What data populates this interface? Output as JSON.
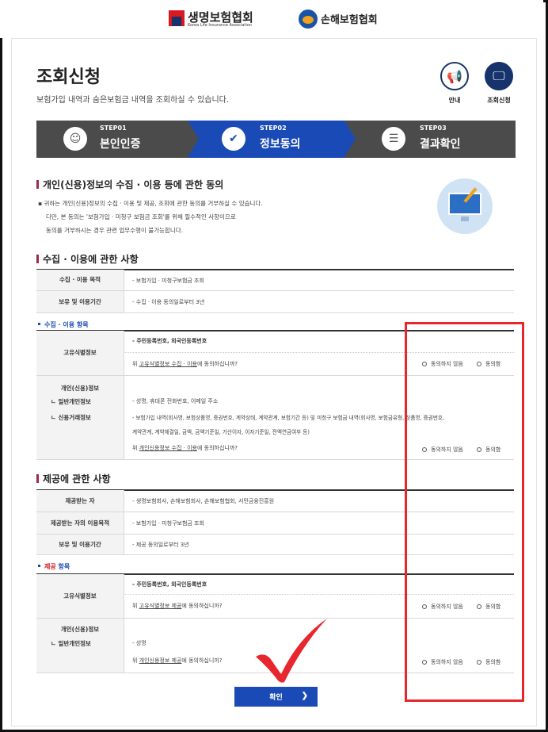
{
  "header": {
    "logo1_text": "생명보험협회",
    "logo1_sub": "Korea Life Insurance Association",
    "logo2_text": "손해보험협회"
  },
  "page": {
    "title": "조회신청",
    "description": "보험가입 내역과 숨은보험금 내역을 조회하실 수 있습니다."
  },
  "top_icons": [
    {
      "label": "안내",
      "icon": "megaphone-icon"
    },
    {
      "label": "조회신청",
      "icon": "monitor-icon"
    }
  ],
  "steps": [
    {
      "num": "STEP01",
      "label": "본인인증",
      "icon": "user-icon"
    },
    {
      "num": "STEP02",
      "label": "정보동의",
      "icon": "check-icon"
    },
    {
      "num": "STEP03",
      "label": "결과확인",
      "icon": "document-icon"
    }
  ],
  "section1": {
    "title": "개인(신용)정보의 수집 · 이용 등에 관한 동의",
    "notes": [
      "귀하는 개인(신용)정보의 수집 · 이용 및 제공, 조회에 관한 동의를 거부하실 수 있습니다.",
      "다만, 본 동의는 '보험가입 · 미청구 보험금 조회'를 위해 필수적인 사항이므로",
      "동의를 거부하시는 경우 관련 업무수행이 불가능합니다."
    ]
  },
  "collect": {
    "title": "수집 · 이용에 관한 사항",
    "rows": [
      {
        "th": "수집 · 이용 목적",
        "td": "- 보험가입 · 미청구보험금 조회"
      },
      {
        "th": "보유 및 이용기간",
        "td": "- 수집 · 이용 동의일로부터 3년"
      }
    ],
    "items_title": "수집 · 이용 항목",
    "id_th": "고유식별정보",
    "id_line1": "- 주민등록번호, 외국인등록번호",
    "id_q_pre": "위 ",
    "id_q_link": "고유식별정보 수집 · 이용",
    "id_q_post": "에 동의하십니까?",
    "pi_th1": "개인(신용)정보",
    "pi_th2": "ㄴ 일반개인정보",
    "pi_th3": "ㄴ 신용거래정보",
    "pi_line1": "- 성명, 휴대폰 전화번호, 이메일 주소",
    "pi_line2": "- 보험가입 내역(회사명, 보험상품명, 증권번호, 계약상태, 계약관계, 보험기간 등) 및 미청구 보험금 내역(회사명, 보험금유형, 상품명, 증권번호,",
    "pi_line3": "계약관계, 계약체결일, 금액, 금액기준일, 가산이자, 이자기준일, 전액연금여부 등)",
    "pi_q_pre": "위 ",
    "pi_q_link": "개인신용정보 수집 · 이용",
    "pi_q_post": "에 동의하십니까?"
  },
  "provide": {
    "title": "제공에 관한 사항",
    "rows": [
      {
        "th": "제공받는 자",
        "td": "- 생명보험회사, 손해보험회사, 손해보험협회, 서민금융진흥원"
      },
      {
        "th": "제공받는 자의 이용목적",
        "td": "- 보험가입 · 미청구보험금 조회"
      },
      {
        "th": "보유 및 이용기간",
        "td": "- 제공 동의일로부터 3년"
      }
    ],
    "items_title_a": "제공",
    "items_title_b": " 항목",
    "id_th": "고유식별정보",
    "id_line1": "- 주민등록번호, 외국인등록번호",
    "id_q_pre": "위 ",
    "id_q_link": "고유식별정보 제공",
    "id_q_post": "에 동의하십니까?",
    "pi_th1": "개인(신용)정보",
    "pi_th2": "ㄴ 일반개인정보",
    "pi_line1": "- 성명",
    "pi_q_pre": "위 ",
    "pi_q_link": "개인신용정보 제공",
    "pi_q_post": "에 동의하십니까?"
  },
  "radio": {
    "disagree": "동의하지 않음",
    "agree": "동의함"
  },
  "confirm_label": "확인",
  "colors": {
    "navy": "#17336c",
    "blue": "#1a4ab5",
    "red": "#e8262e",
    "gray": "#4b4b4b"
  }
}
